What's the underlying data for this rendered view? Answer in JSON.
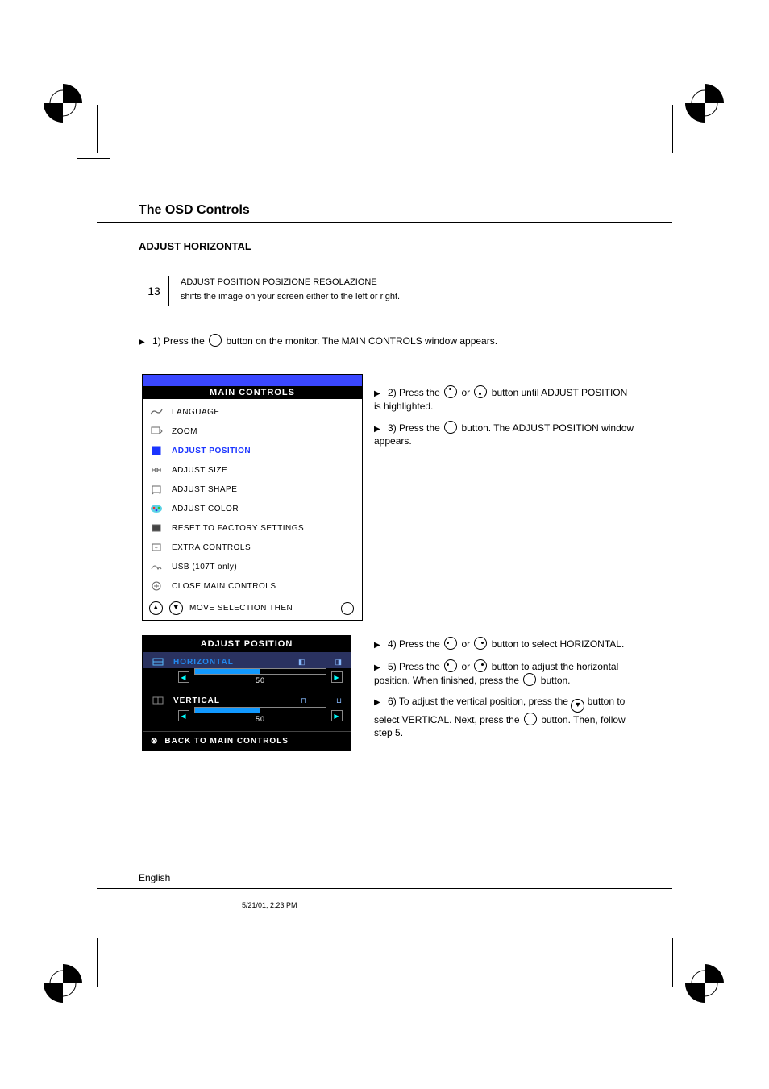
{
  "header": {
    "title": "The OSD Controls",
    "subtitle": "ADJUST HORIZONTAL",
    "page_number": "13",
    "sub_line1": "ADJUST POSITION POSIZIONE REGOLAZIONE",
    "sub_line2": "shifts the image on your screen either to the left or right."
  },
  "step1": {
    "prefix": "1) Press the",
    "suffix": "button on the monitor. The MAIN CONTROLS window appears."
  },
  "osd_main": {
    "title": "MAIN CONTROLS",
    "items": [
      "LANGUAGE",
      "ZOOM",
      "ADJUST POSITION",
      "ADJUST SIZE",
      "ADJUST SHAPE",
      "ADJUST COLOR",
      "RESET TO FACTORY SETTINGS",
      "EXTRA CONTROLS",
      "USB (107T only)",
      "CLOSE MAIN CONTROLS"
    ],
    "selected_index": 2,
    "footer_move": "MOVE SELECTION THEN",
    "footer_icon": "ad"
  },
  "right_steps_a": {
    "s2_a": "2) Press the",
    "s2_b": "or",
    "s2_c": "button until ADJUST POSITION is highlighted.",
    "s3_a": "3) Press the",
    "s3_b": "button. The ADJUST POSITION window appears."
  },
  "osd_adjust": {
    "title": "ADJUST POSITION",
    "rows": [
      {
        "label": "HORIZONTAL",
        "value": 50,
        "selected": true
      },
      {
        "label": "VERTICAL",
        "value": 50,
        "selected": false
      }
    ],
    "back": "BACK TO MAIN CONTROLS"
  },
  "right_steps_b": {
    "s4_a": "4) Press the",
    "s4_b": "or",
    "s4_c": "button to select HORIZONTAL.",
    "s5_a": "5) Press the",
    "s5_b": "or",
    "s5_c": "button to adjust the horizontal position. When finished, press the",
    "s5_d": "button.",
    "s6_a": "6) To adjust the vertical position, press the",
    "s6_b": "button to select VERTICAL. Next, press the",
    "s6_c": "button. Then, follow step 5."
  },
  "footer": {
    "english": "English",
    "note": "5/21/01, 2:23 PM"
  }
}
